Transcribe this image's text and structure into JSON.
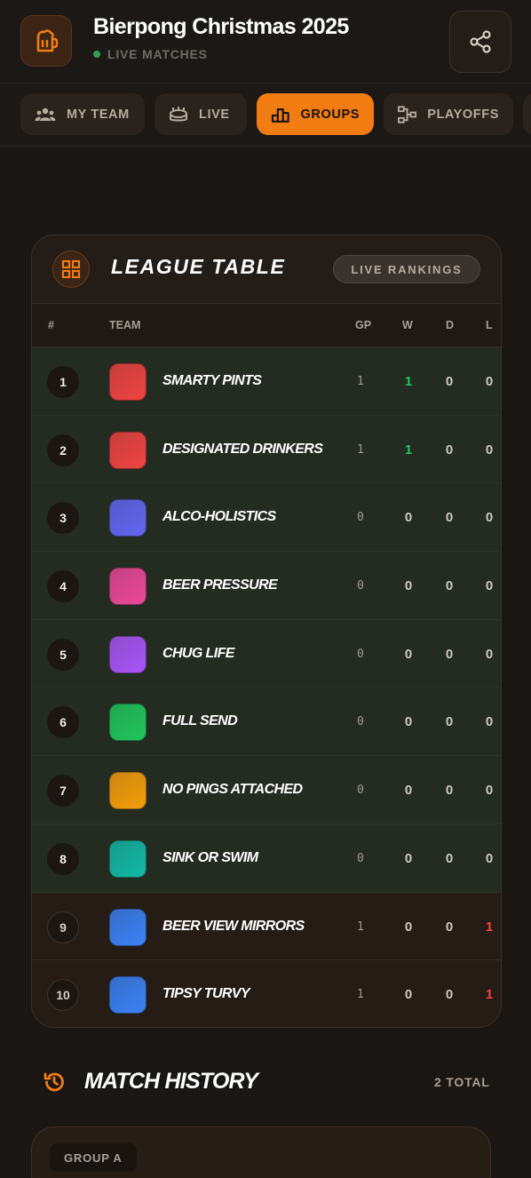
{
  "header": {
    "title": "Bierpong Christmas 2025",
    "subtitle": "LIVE MATCHES"
  },
  "tabs": [
    {
      "label": "MY TEAM",
      "icon": "users-icon",
      "active": false
    },
    {
      "label": "LIVE",
      "icon": "stadium-icon",
      "active": false
    },
    {
      "label": "GROUPS",
      "icon": "podium-icon",
      "active": true
    },
    {
      "label": "PLAYOFFS",
      "icon": "bracket-icon",
      "active": false
    }
  ],
  "league": {
    "title": "LEAGUE TABLE",
    "badge": "LIVE RANKINGS",
    "columns": {
      "rank": "#",
      "team": "TEAM",
      "gp": "GP",
      "w": "W",
      "d": "D",
      "l": "L"
    },
    "rows": [
      {
        "rank": "1",
        "team": "SMARTY PINTS",
        "gp": "1",
        "w": "1",
        "d": "0",
        "l": "0",
        "color": "#ef4444",
        "qualified": true
      },
      {
        "rank": "2",
        "team": "DESIGNATED DRINKERS",
        "gp": "1",
        "w": "1",
        "d": "0",
        "l": "0",
        "color": "#ef4444",
        "qualified": true
      },
      {
        "rank": "3",
        "team": "ALCO-HOLISTICS",
        "gp": "0",
        "w": "0",
        "d": "0",
        "l": "0",
        "color": "#6366f1",
        "qualified": true
      },
      {
        "rank": "4",
        "team": "BEER PRESSURE",
        "gp": "0",
        "w": "0",
        "d": "0",
        "l": "0",
        "color": "#ec4899",
        "qualified": true
      },
      {
        "rank": "5",
        "team": "CHUG LIFE",
        "gp": "0",
        "w": "0",
        "d": "0",
        "l": "0",
        "color": "#a855f7",
        "qualified": true
      },
      {
        "rank": "6",
        "team": "FULL SEND",
        "gp": "0",
        "w": "0",
        "d": "0",
        "l": "0",
        "color": "#22c55e",
        "qualified": true
      },
      {
        "rank": "7",
        "team": "NO PINGS ATTACHED",
        "gp": "0",
        "w": "0",
        "d": "0",
        "l": "0",
        "color": "#f59e0b",
        "qualified": true
      },
      {
        "rank": "8",
        "team": "SINK OR SWIM",
        "gp": "0",
        "w": "0",
        "d": "0",
        "l": "0",
        "color": "#14b8a6",
        "qualified": true
      },
      {
        "rank": "9",
        "team": "BEER VIEW MIRRORS",
        "gp": "1",
        "w": "0",
        "d": "0",
        "l": "1",
        "color": "#3b82f6",
        "qualified": false
      },
      {
        "rank": "10",
        "team": "TIPSY TURVY",
        "gp": "1",
        "w": "0",
        "d": "0",
        "l": "1",
        "color": "#3b82f6",
        "qualified": false
      }
    ]
  },
  "match_history": {
    "title": "MATCH HISTORY",
    "count": "2 TOTAL",
    "first_group": "GROUP A"
  },
  "colors": {
    "accent": "#f07c12",
    "win": "#22c55e",
    "loss": "#ef4444",
    "live": "#2e9d4e"
  }
}
